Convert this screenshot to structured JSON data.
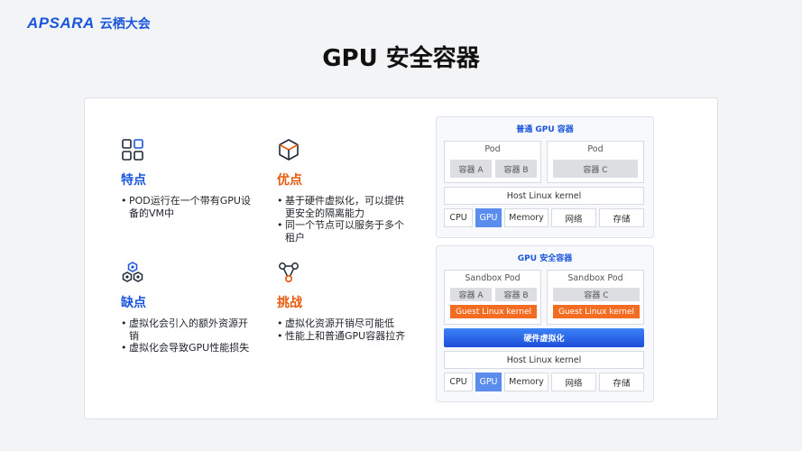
{
  "header": {
    "logo_mark": "APSARA",
    "logo_sub": "云栖大会"
  },
  "title": "GPU 安全容器",
  "quadrants": [
    {
      "key": "features",
      "title": "特点",
      "icon": "grid-icon",
      "bullets": [
        "POD运行在一个带有GPU设备的VM中"
      ]
    },
    {
      "key": "pros",
      "title": "优点",
      "icon": "cube-icon",
      "bullets": [
        "基于硬件虚拟化，可以提供更安全的隔离能力",
        "同一个节点可以服务于多个租户"
      ]
    },
    {
      "key": "cons",
      "title": "缺点",
      "icon": "hexagon-cluster-icon",
      "bullets": [
        "虚拟化会引入的额外资源开销",
        "虚拟化会导致GPU性能损失"
      ]
    },
    {
      "key": "challenges",
      "title": "挑战",
      "icon": "network-icon",
      "bullets": [
        "虚拟化资源开销尽可能低",
        "性能上和普通GPU容器拉齐"
      ]
    }
  ],
  "normal": {
    "title": "普通 GPU 容器",
    "pod1": {
      "label": "Pod",
      "c1": "容器 A",
      "c2": "容器 B"
    },
    "pod2": {
      "label": "Pod",
      "c1": "容器 C"
    },
    "kernel": "Host Linux kernel",
    "hw": [
      "CPU",
      "GPU",
      "Memory",
      "网络",
      "存储"
    ]
  },
  "secure": {
    "title": "GPU 安全容器",
    "pod1": {
      "label": "Sandbox Pod",
      "c1": "容器 A",
      "c2": "容器 B",
      "kernel": "Guest Linux kernel"
    },
    "pod2": {
      "label": "Sandbox Pod",
      "c1": "容器 C",
      "kernel": "Guest Linux kernel"
    },
    "virt": "硬件虚拟化",
    "kernel": "Host Linux kernel",
    "hw": [
      "CPU",
      "GPU",
      "Memory",
      "网络",
      "存储"
    ]
  },
  "colors": {
    "blue": "#1a56db",
    "orange": "#e8590c",
    "kernel_orange": "#f26d21",
    "gpu_active": "#5b8def"
  }
}
